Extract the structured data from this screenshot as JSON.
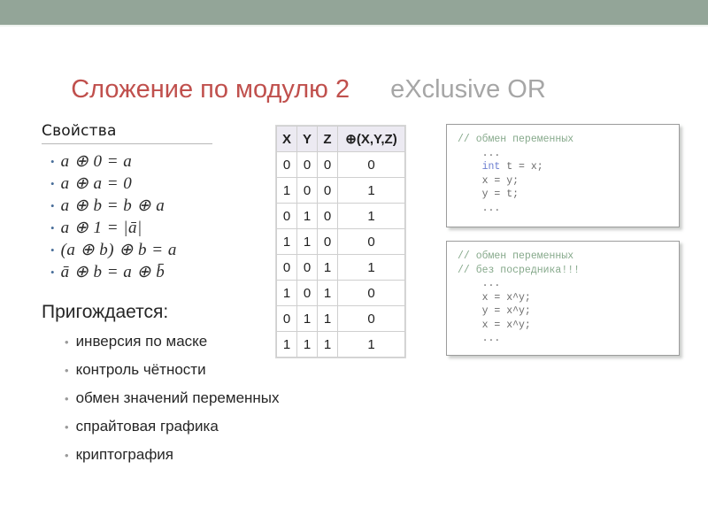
{
  "slide": {
    "top_band_color": "#93a598",
    "accent_red": "#c0504d",
    "accent_gray": "#a6a6a6",
    "title_red": "Сложение по модулю 2",
    "title_gray": "eXclusive OR"
  },
  "properties": {
    "heading": "Свойства",
    "items": [
      {
        "bullet": "•",
        "formula": "a ⊕ 0 = a"
      },
      {
        "bullet": "•",
        "formula": "a ⊕ a = 0"
      },
      {
        "bullet": "•",
        "formula": "a ⊕ b = b ⊕ a"
      },
      {
        "bullet": "•",
        "formula": "a ⊕ 1 = |ā|"
      },
      {
        "bullet": "•",
        "formula": "(a ⊕ b) ⊕ b = a"
      },
      {
        "bullet": "•",
        "formula": "ā ⊕ b = a ⊕ b̄"
      }
    ]
  },
  "useful": {
    "heading": "Пригождается:",
    "items": [
      "инверсия по маске",
      "контроль чётности",
      "обмен значений переменных",
      "спрайтовая графика",
      "криптография"
    ],
    "bullet": "•"
  },
  "truth_table": {
    "headers": [
      "X",
      "Y",
      "Z",
      "⊕(X,Y,Z)"
    ],
    "rows": [
      [
        "0",
        "0",
        "0",
        "0"
      ],
      [
        "1",
        "0",
        "0",
        "1"
      ],
      [
        "0",
        "1",
        "0",
        "1"
      ],
      [
        "1",
        "1",
        "0",
        "0"
      ],
      [
        "0",
        "0",
        "1",
        "1"
      ],
      [
        "1",
        "0",
        "1",
        "0"
      ],
      [
        "0",
        "1",
        "1",
        "0"
      ],
      [
        "1",
        "1",
        "1",
        "1"
      ]
    ]
  },
  "code_box_1": {
    "lines": [
      {
        "comment": "// обмен переменных",
        "code": ""
      },
      {
        "comment": "",
        "code": "    ..."
      },
      {
        "comment": "",
        "keyword": "    int",
        "code": " t = x;"
      },
      {
        "comment": "",
        "code": "    x = y;"
      },
      {
        "comment": "",
        "code": "    y = t;"
      },
      {
        "comment": "",
        "code": "    ..."
      }
    ]
  },
  "code_box_2": {
    "lines": [
      {
        "comment": "// обмен переменных",
        "code": ""
      },
      {
        "comment": "// без посредника!!!",
        "code": ""
      },
      {
        "comment": "",
        "code": "    ..."
      },
      {
        "comment": "",
        "code": "    x = x^y;"
      },
      {
        "comment": "",
        "code": "    y = x^y;"
      },
      {
        "comment": "",
        "code": "    x = x^y;"
      },
      {
        "comment": "",
        "code": "    ..."
      }
    ]
  }
}
